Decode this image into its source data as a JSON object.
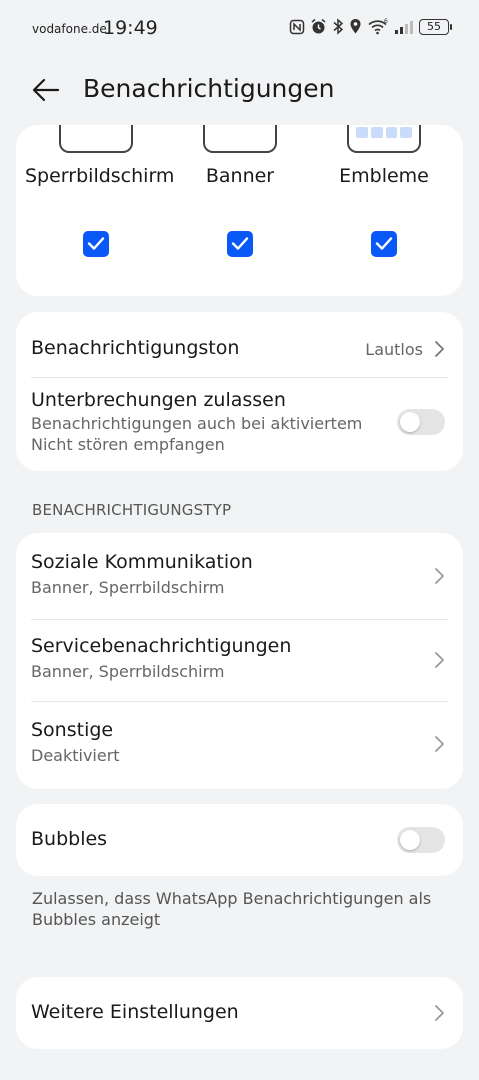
{
  "status_bar": {
    "carrier": "vodafone.de",
    "time": "19:49",
    "battery": "55",
    "icons": [
      "nfc-icon",
      "alarm-icon",
      "bluetooth-icon",
      "location-icon",
      "wifi-icon",
      "signal-icon",
      "battery-icon"
    ]
  },
  "header": {
    "title": "Benachrichtigungen",
    "back_icon": "back-arrow-icon"
  },
  "styles": {
    "items": [
      {
        "label": "Sperrbildschirm",
        "checked": true
      },
      {
        "label": "Banner",
        "checked": true
      },
      {
        "label": "Embleme",
        "checked": true
      }
    ],
    "accent_color": "#0a59f7"
  },
  "sound_card": {
    "tone_title": "Benachrichtigungston",
    "tone_value": "Lautlos",
    "interrupt_title": "Unterbrechungen zulassen",
    "interrupt_sub": "Benachrichtigungen auch bei aktiviertem Nicht stören empfangen",
    "interrupt_enabled": false
  },
  "type_section": {
    "header": "BENACHRICHTIGUNGSTYP",
    "items": [
      {
        "title": "Soziale Kommunikation",
        "sub": "Banner, Sperrbildschirm"
      },
      {
        "title": "Servicebenachrichtigungen",
        "sub": "Banner, Sperrbildschirm"
      },
      {
        "title": "Sonstige",
        "sub": "Deaktiviert"
      }
    ]
  },
  "bubbles": {
    "title": "Bubbles",
    "enabled": false,
    "note": "Zulassen, dass WhatsApp Benachrichtigungen als Bubbles anzeigt"
  },
  "more": {
    "title": "Weitere Einstellungen"
  }
}
